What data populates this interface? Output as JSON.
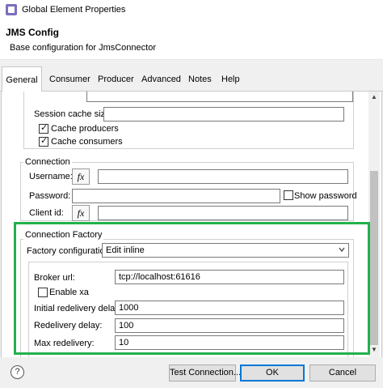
{
  "window": {
    "title": "Global Element Properties"
  },
  "header": {
    "title": "JMS Config",
    "subtitle": "Base configuration for JmsConnector"
  },
  "tabs": [
    "General",
    "Consumer",
    "Producer",
    "Advanced",
    "Notes",
    "Help"
  ],
  "active_tab": "General",
  "session": {
    "cache_size_label": "Session cache size:",
    "cache_size_value": "",
    "cache_producers_label": "Cache producers",
    "cache_producers_checked": true,
    "cache_consumers_label": "Cache consumers",
    "cache_consumers_checked": true
  },
  "connection": {
    "title": "Connection",
    "username_label": "Username:",
    "username_value": "",
    "password_label": "Password:",
    "password_value": "",
    "show_password_label": "Show password",
    "show_password_checked": false,
    "client_id_label": "Client id:",
    "client_id_value": "",
    "fx_label": "fx"
  },
  "connection_factory": {
    "title": "Connection Factory",
    "factory_config_label": "Factory configuration",
    "factory_config_value": "Edit inline",
    "broker_url_label": "Broker url:",
    "broker_url_value": "tcp://localhost:61616",
    "enable_xa_label": "Enable xa",
    "enable_xa_checked": false,
    "initial_redelivery_delay_label": "Initial redelivery delay:",
    "initial_redelivery_delay_value": "1000",
    "redelivery_delay_label": "Redelivery delay:",
    "redelivery_delay_value": "100",
    "max_redelivery_label": "Max redelivery:",
    "max_redelivery_value": "10"
  },
  "footer": {
    "help_symbol": "?",
    "test_connection_label": "Test Connection...",
    "ok_label": "OK",
    "cancel_label": "Cancel"
  },
  "colors": {
    "highlight": "#22b14c",
    "default_button_border": "#0078d7"
  }
}
